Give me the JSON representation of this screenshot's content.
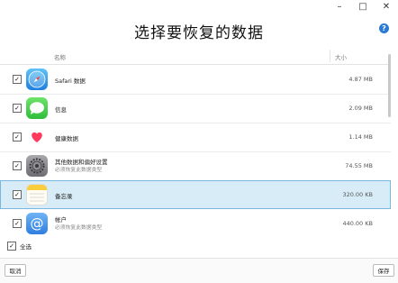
{
  "window": {
    "minimize": "–",
    "maximize": "□",
    "close": "✕"
  },
  "header": {
    "title": "选择要恢复的数据",
    "help": "?"
  },
  "columns": {
    "name": "名称",
    "size": "大小"
  },
  "items": [
    {
      "name": "Safari 数据",
      "size": "4.87 MB",
      "checked": true,
      "icon": "safari-icon"
    },
    {
      "name": "信息",
      "size": "2.09 MB",
      "checked": true,
      "icon": "messages-icon"
    },
    {
      "name": "健康数据",
      "size": "1.14 MB",
      "checked": true,
      "icon": "health-icon"
    },
    {
      "name": "其他数据和偏好设置",
      "subtitle": "必须恢复此数据类型",
      "size": "74.55 MB",
      "checked": true,
      "icon": "settings-icon"
    },
    {
      "name": "备忘录",
      "size": "320.00 KB",
      "checked": true,
      "icon": "notes-icon",
      "selected": true
    },
    {
      "name": "帐户",
      "subtitle": "必须恢复此数据类型",
      "size": "440.00 KB",
      "checked": true,
      "icon": "accounts-icon"
    }
  ],
  "select_all": {
    "label": "全选",
    "checked": true
  },
  "footer": {
    "cancel": "取消",
    "save": "保存"
  }
}
